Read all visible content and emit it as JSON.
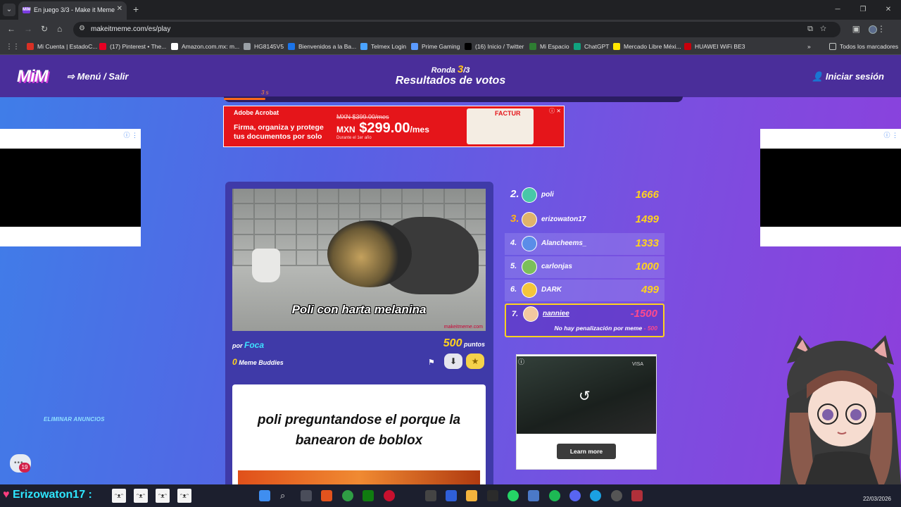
{
  "browser": {
    "tab_title": "En juego 3/3 - Make it Meme",
    "tab_favicon_text": "MIM",
    "url": "makeitmeme.com/es/play",
    "bookmarks": [
      {
        "label": "Mi Cuenta | EstadoC...",
        "color": "#d93025"
      },
      {
        "label": "(17) Pinterest • The...",
        "color": "#e60023"
      },
      {
        "label": "Amazon.com.mx: m...",
        "color": "#ffffff"
      },
      {
        "label": "HG8145V5",
        "color": "#9aa0a6"
      },
      {
        "label": "Bienvenidos a la Ba...",
        "color": "#1a73e8"
      },
      {
        "label": "Telmex Login",
        "color": "#4aa3ff"
      },
      {
        "label": "Prime Gaming",
        "color": "#5b9bff"
      },
      {
        "label": "(16) Inicio / Twitter",
        "color": "#000000"
      },
      {
        "label": "Mi Espacio",
        "color": "#2e7d32"
      },
      {
        "label": "ChatGPT",
        "color": "#10a37f"
      },
      {
        "label": "Mercado Libre Méxi...",
        "color": "#ffe600"
      },
      {
        "label": "HUAWEI WiFi BE3",
        "color": "#c7000b"
      }
    ],
    "all_bookmarks": "Todos los marcadores"
  },
  "header": {
    "logo": "MiM",
    "menu_link": "Menú / Salir",
    "round_label": "Ronda",
    "round_current": "3",
    "round_total": "/3",
    "title": "Resultados de votos",
    "login": "Iniciar sesión",
    "timer_text": "3 s",
    "timer_progress": 0.09
  },
  "ad_banner": {
    "brand": "Adobe Acrobat",
    "text": "Firma, organiza y protege tus documentos por solo",
    "old_price": "MXN $399.00/mes",
    "currency": "MXN",
    "price": "$299.00",
    "per": "/mes",
    "note": "Durante el 1er año",
    "visual_label": "FACTUR"
  },
  "meme": {
    "caption": "Poli con harta melanina",
    "watermark": "makeitmeme.com",
    "by_label": "por",
    "author": "Foca",
    "points": "500",
    "points_label": "puntos",
    "buddies_count": "0",
    "buddies_label": "Meme Buddies",
    "next_caption": "poli preguntandose el porque la banearon de boblox"
  },
  "leaderboard": {
    "rows": [
      {
        "rank": "2.",
        "name": "poli",
        "score": "1666",
        "avatar_color": "#48c7a8"
      },
      {
        "rank": "3.",
        "name": "erizowaton17",
        "score": "1499",
        "avatar_color": "#e0b36a"
      },
      {
        "rank": "4.",
        "name": "Alancheems_",
        "score": "1333",
        "avatar_color": "#5a8de8"
      },
      {
        "rank": "5.",
        "name": "carlonjas",
        "score": "1000",
        "avatar_color": "#7bbf5a"
      },
      {
        "rank": "6.",
        "name": "DARK",
        "score": "499",
        "avatar_color": "#f3c53a"
      }
    ],
    "me": {
      "rank": "7.",
      "name": "nanniee",
      "score": "-1500",
      "avatar_color": "#f2c8a0",
      "penalty_text": "No hay penalización por meme",
      "penalty_value": "- 500"
    }
  },
  "video_ad": {
    "brand": "VISA",
    "cta": "Learn more"
  },
  "sidebar": {
    "remove_ads": "ELIMINAR ANUNCIOS",
    "chat_badge": "19"
  },
  "taskbar": {
    "stream_name": "Erizowaton17 :",
    "date": "22/03/2026"
  }
}
